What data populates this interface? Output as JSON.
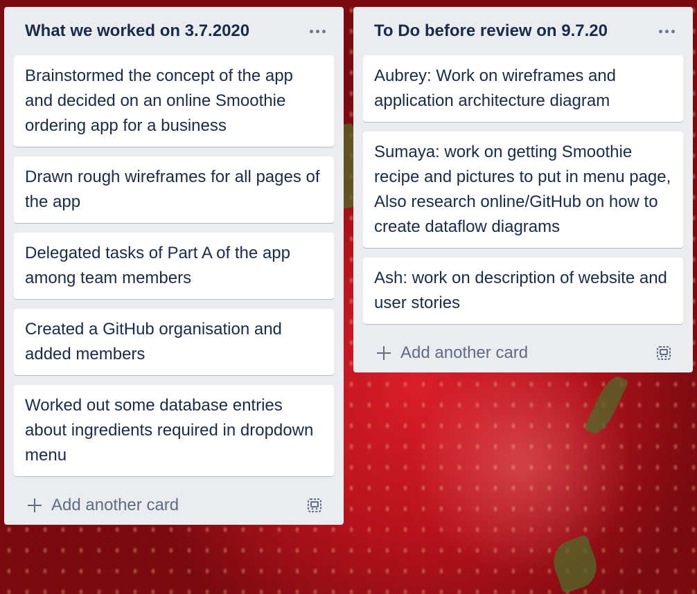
{
  "lists": [
    {
      "title": "What we worked on 3.7.2020",
      "cards": [
        "Brainstormed the concept of the app and decided on an online Smoothie ordering app for a business",
        "Drawn rough wireframes for all pages of the app",
        "Delegated tasks of Part A of the app among team members",
        "Created a GitHub organisation and added members",
        "Worked out some database entries about ingredients required in dropdown menu"
      ],
      "add_card_label": "Add another card"
    },
    {
      "title": "To Do before review on 9.7.20",
      "cards": [
        "Aubrey: Work on wireframes and application architecture diagram",
        "Sumaya: work on getting Smoothie recipe and pictures to put in menu page, Also research online/GitHub on how to create dataflow diagrams",
        "Ash: work on description of website and user stories"
      ],
      "add_card_label": "Add another card"
    }
  ],
  "icons": {
    "list_menu": "ellipsis-icon",
    "add": "plus-icon",
    "template": "card-template-icon"
  },
  "colors": {
    "list_bg": "#ebecf0",
    "card_bg": "#ffffff",
    "text": "#172b4d",
    "muted": "#5e6c84"
  }
}
